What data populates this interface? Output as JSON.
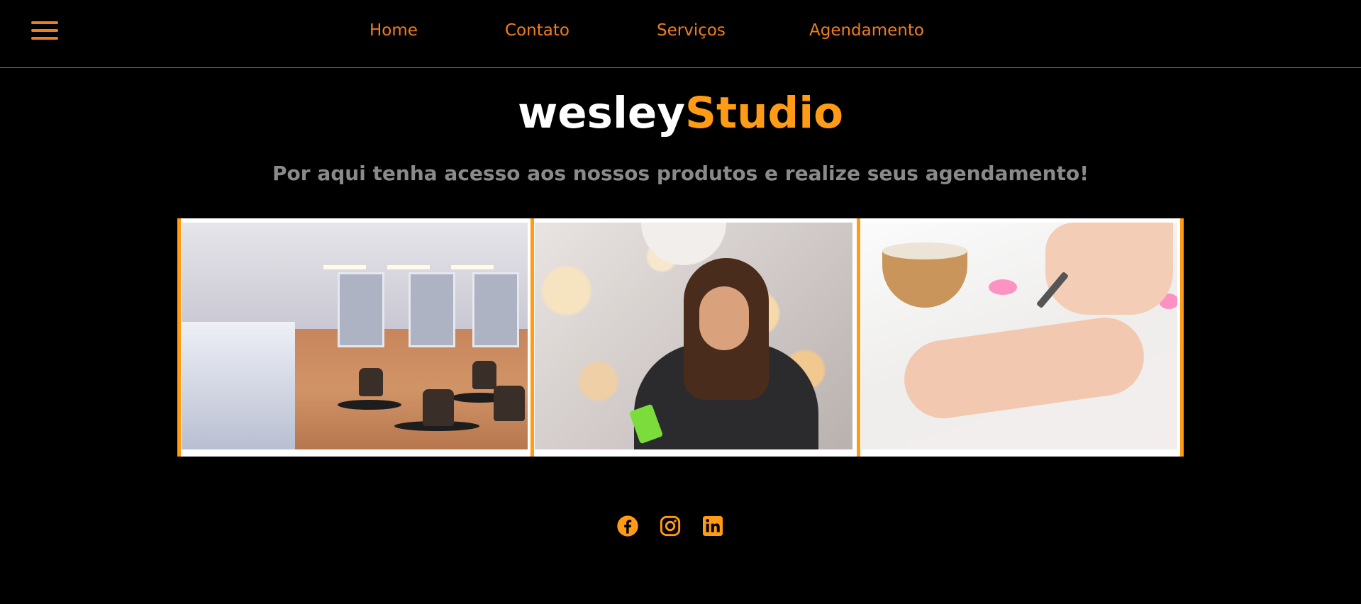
{
  "nav": {
    "menu_icon": "hamburger-menu-icon",
    "links": [
      {
        "label": "Home"
      },
      {
        "label": "Contato"
      },
      {
        "label": "Serviços"
      },
      {
        "label": "Agendamento"
      }
    ]
  },
  "brand": {
    "part1": "wesley",
    "part2": "Studio"
  },
  "tagline": "Por aqui tenha acesso aos nossos produtos e realize seus agendamento!",
  "gallery": {
    "images": [
      {
        "name": "salon-interior-photo"
      },
      {
        "name": "hair-styling-photo"
      },
      {
        "name": "manicure-photo"
      }
    ]
  },
  "socials": [
    {
      "icon": "facebook-icon"
    },
    {
      "icon": "instagram-icon"
    },
    {
      "icon": "linkedin-icon"
    }
  ],
  "colors": {
    "background": "#000000",
    "accent": "#ff9b14",
    "nav_text": "#f07e1b",
    "tagline": "#8a8a8a"
  }
}
